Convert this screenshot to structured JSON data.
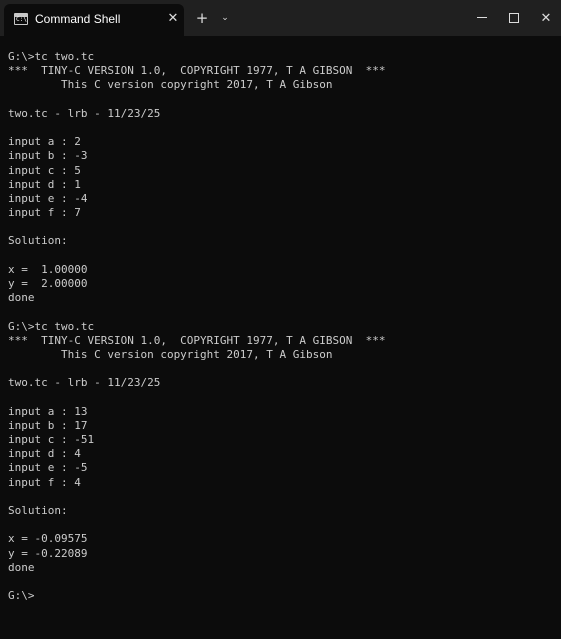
{
  "window": {
    "tab_title": "Command Shell",
    "tab_close_glyph": "✕",
    "new_tab_glyph": "+",
    "dropdown_glyph": "⌄",
    "minimize_icon": "minimize-icon",
    "maximize_icon": "maximize-icon",
    "close_glyph": "✕",
    "app_icon": "terminal-icon",
    "app_icon_glyph": "C:\\",
    "colors": {
      "titlebar": "#202020",
      "background": "#0c0c0c",
      "text": "#cccccc"
    }
  },
  "console": {
    "lines": [
      "G:\\>tc two.tc",
      "***  TINY-C VERSION 1.0,  COPYRIGHT 1977, T A GIBSON  ***",
      "        This C version copyright 2017, T A Gibson",
      "",
      "two.tc - lrb - 11/23/25",
      "",
      "input a : 2",
      "input b : -3",
      "input c : 5",
      "input d : 1",
      "input e : -4",
      "input f : 7",
      "",
      "Solution:",
      "",
      "x =  1.00000",
      "y =  2.00000",
      "done",
      "",
      "G:\\>tc two.tc",
      "***  TINY-C VERSION 1.0,  COPYRIGHT 1977, T A GIBSON  ***",
      "        This C version copyright 2017, T A Gibson",
      "",
      "two.tc - lrb - 11/23/25",
      "",
      "input a : 13",
      "input b : 17",
      "input c : -51",
      "input d : 4",
      "input e : -5",
      "input f : 4",
      "",
      "Solution:",
      "",
      "x = -0.09575",
      "y = -0.22089",
      "done",
      "",
      "G:\\>"
    ]
  }
}
